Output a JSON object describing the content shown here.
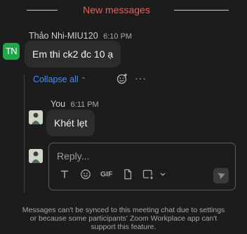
{
  "divider": {
    "label": "New messages",
    "color": "#e0615e"
  },
  "message": {
    "avatar_initials": "TN",
    "avatar_color": "#1fa74a",
    "sender": "Thảo Nhi-MIU120",
    "time": "6:10 PM",
    "text": "Em thi ck2 đc 10 ạ"
  },
  "thread": {
    "collapse_label": "Collapse all",
    "reply": {
      "sender": "You",
      "time": "6:11 PM",
      "text": "Khét lẹt"
    }
  },
  "composer": {
    "placeholder": "Reply...",
    "tools": [
      "text-format-icon",
      "emoji-icon",
      "gif-icon",
      "file-icon",
      "screenshot-icon",
      "chevron-down-icon",
      "send-icon"
    ],
    "gif_label": "GIF"
  },
  "notice": "Messages can't be synced to this meeting chat due to settings or because some participants' Zoom Workplace app can't support this feature."
}
